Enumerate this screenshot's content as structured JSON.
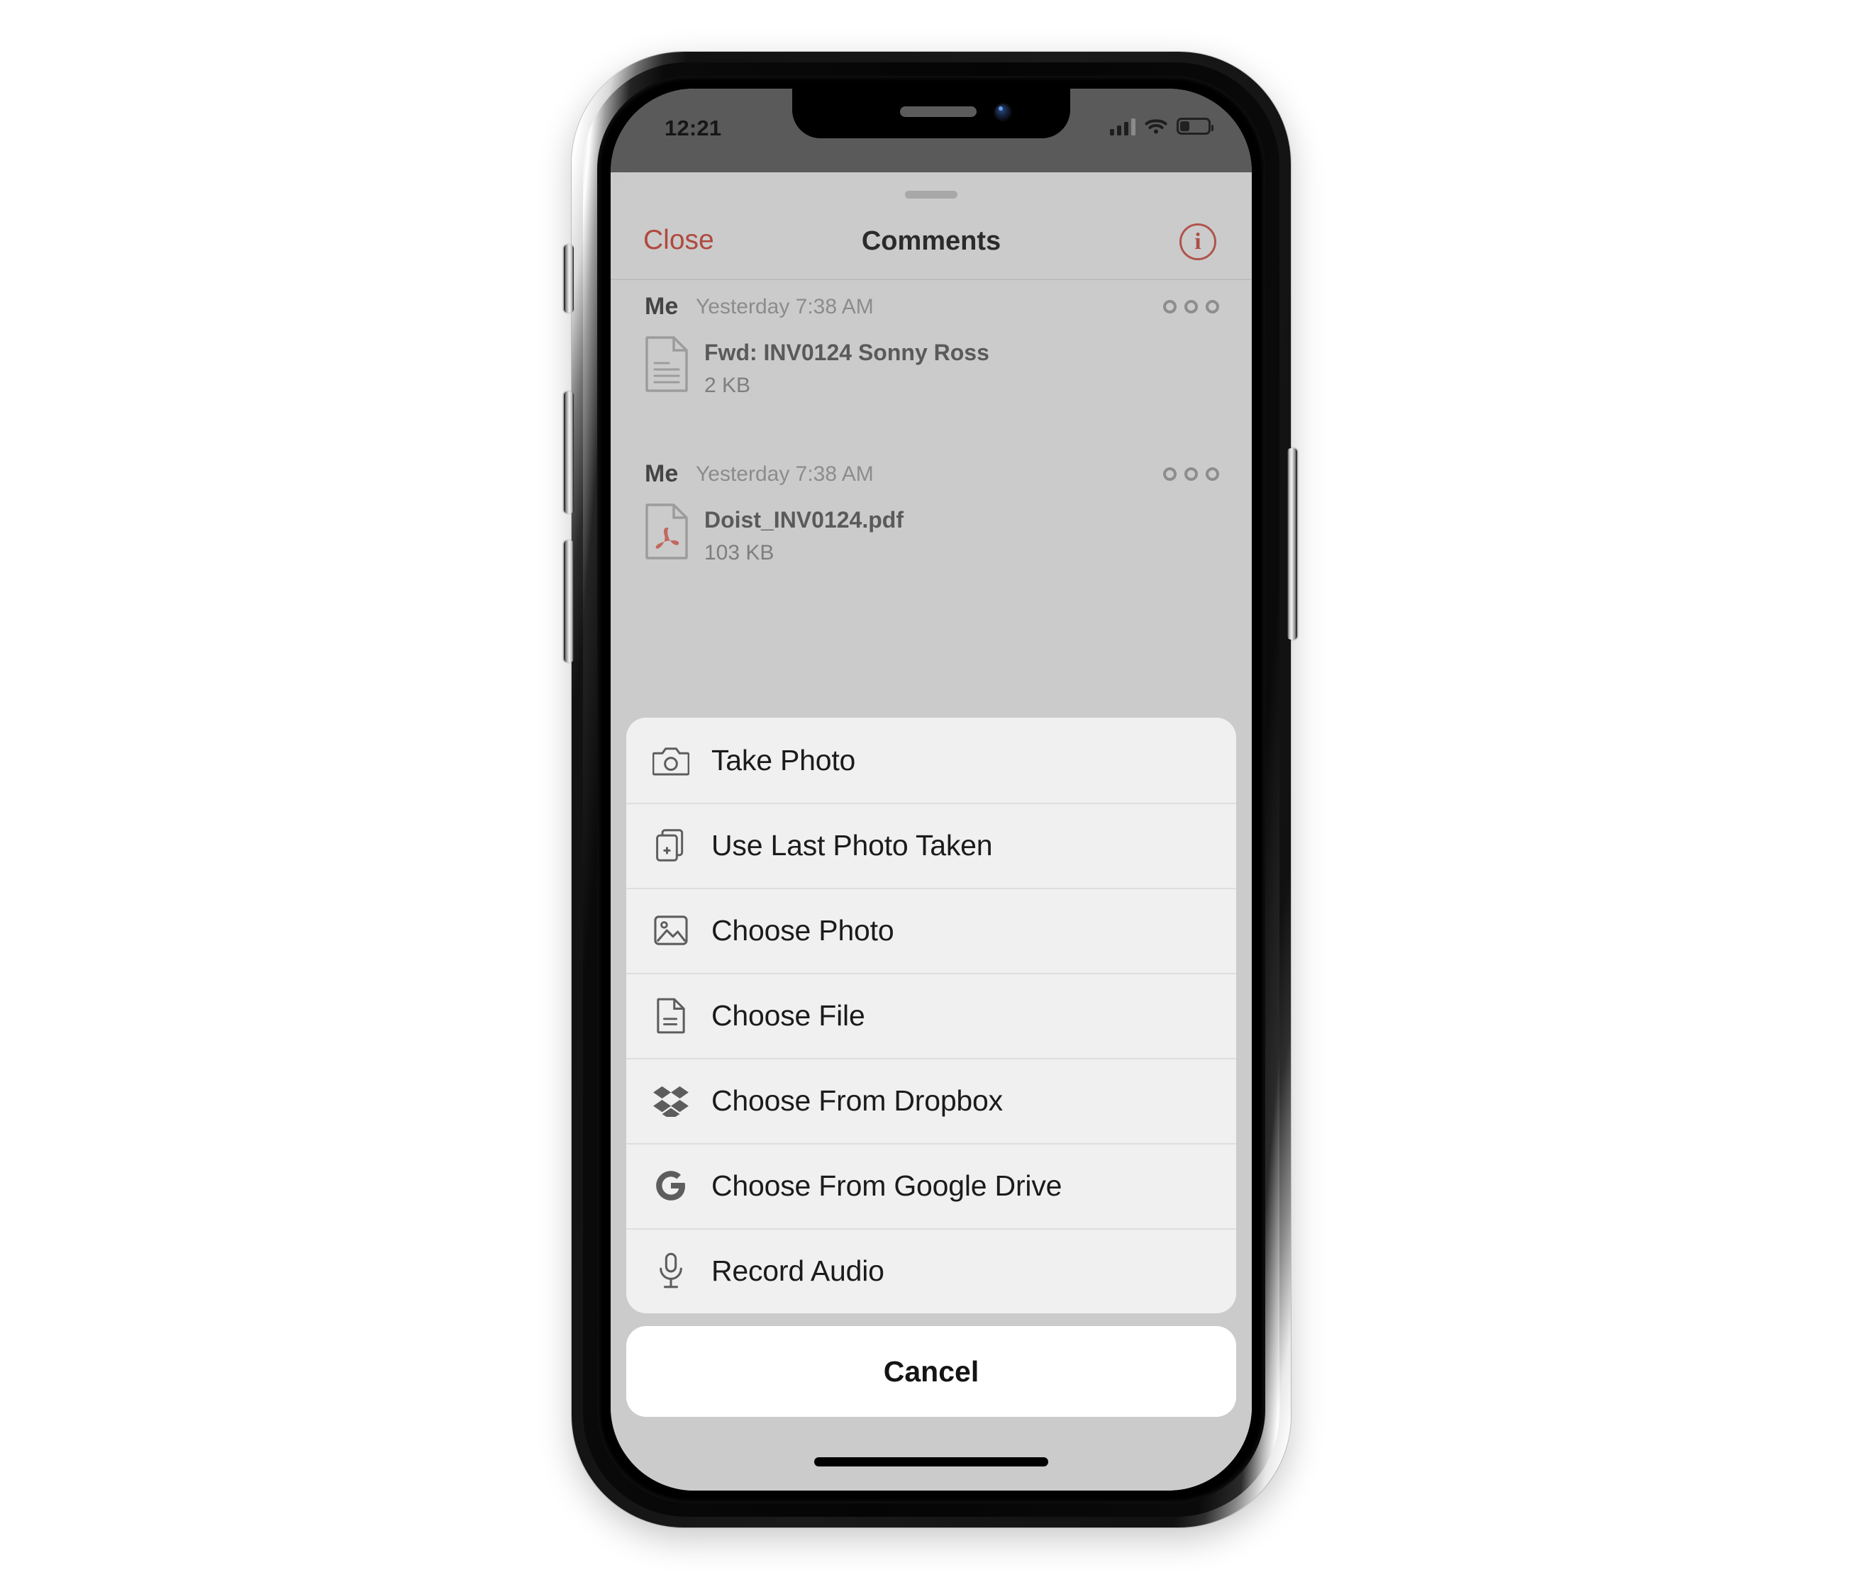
{
  "device": {
    "status_bar": {
      "time": "12:21",
      "signal_icon": "cellular-bars-icon",
      "wifi_icon": "wifi-icon",
      "battery_icon": "battery-icon",
      "battery_level_percent": 30
    },
    "home_indicator": "home-indicator"
  },
  "comments_sheet": {
    "grabber": "sheet-grabber",
    "nav": {
      "close_label": "Close",
      "title": "Comments",
      "info_label": "i",
      "info_icon": "info-circle-icon",
      "close_color": "#b0493f"
    },
    "comments": [
      {
        "author": "Me",
        "timestamp": "Yesterday 7:38 AM",
        "more_icon": "more-options-icon",
        "attachment": {
          "icon": "document-file-icon",
          "name": "Fwd: INV0124 Sonny Ross",
          "size": "2 KB"
        }
      },
      {
        "author": "Me",
        "timestamp": "Yesterday 7:38 AM",
        "more_icon": "more-options-icon",
        "attachment": {
          "icon": "pdf-file-icon",
          "name": "Doist_INV0124.pdf",
          "size": "103 KB"
        }
      }
    ]
  },
  "action_sheet": {
    "items": [
      {
        "label": "Take Photo",
        "icon": "camera-icon"
      },
      {
        "label": "Use Last Photo Taken",
        "icon": "last-photo-icon"
      },
      {
        "label": "Choose Photo",
        "icon": "photo-icon"
      },
      {
        "label": "Choose File",
        "icon": "file-icon"
      },
      {
        "label": "Choose From Dropbox",
        "icon": "dropbox-icon"
      },
      {
        "label": "Choose From Google Drive",
        "icon": "google-icon"
      },
      {
        "label": "Record Audio",
        "icon": "microphone-icon"
      }
    ],
    "cancel_label": "Cancel"
  },
  "colors": {
    "dim_backdrop": "#cacaca",
    "sheet_bg": "#f0f0f0",
    "cancel_bg": "#ffffff",
    "accent_red": "#b0493f",
    "pdf_red": "#c2685f"
  }
}
